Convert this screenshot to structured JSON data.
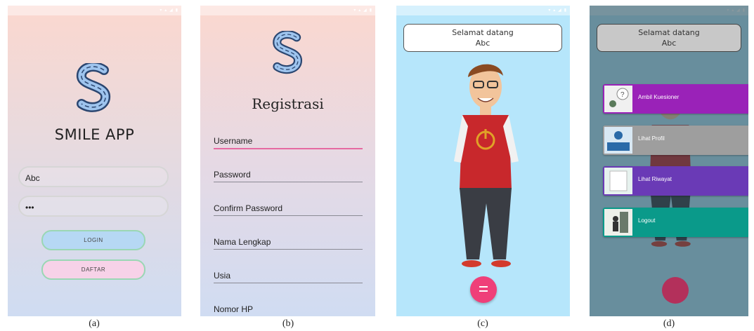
{
  "screens": {
    "login": {
      "app_title": "SMILE APP",
      "username_value": "Abc",
      "password_value": "•••",
      "login_label": "LOGIN",
      "daftar_label": "DAFTAR",
      "caption": "(a)"
    },
    "register": {
      "title": "Registrasi",
      "fields": [
        "Username",
        "Password",
        "Confirm Password",
        "Nama Lengkap",
        "Usia",
        "Nomor HP"
      ],
      "caption": "(b)"
    },
    "home": {
      "greeting_line1": "Selamat datang",
      "greeting_line2": "Abc",
      "fab_icon": "menu-icon",
      "caption": "(c)"
    },
    "menu": {
      "greeting_line1": "Selamat datang",
      "greeting_line2": "Abc",
      "items": [
        {
          "label": "Ambil Kuesioner",
          "color": "#9a22b8",
          "icon": "question-icon"
        },
        {
          "label": "Lihat Profil",
          "color": "#9e9e9e",
          "icon": "profile-icon"
        },
        {
          "label": "Lihat Riwayat",
          "color": "#6a3ab6",
          "icon": "history-icon"
        },
        {
          "label": "Logout",
          "color": "#0a9a8a",
          "icon": "logout-icon"
        }
      ],
      "caption": "(d)"
    }
  },
  "colors": {
    "accent_pink": "#ef3f79",
    "login_button": "#b6d8f4",
    "daftar_button": "#f7d2e8",
    "home_bg": "#b6e6fb"
  }
}
